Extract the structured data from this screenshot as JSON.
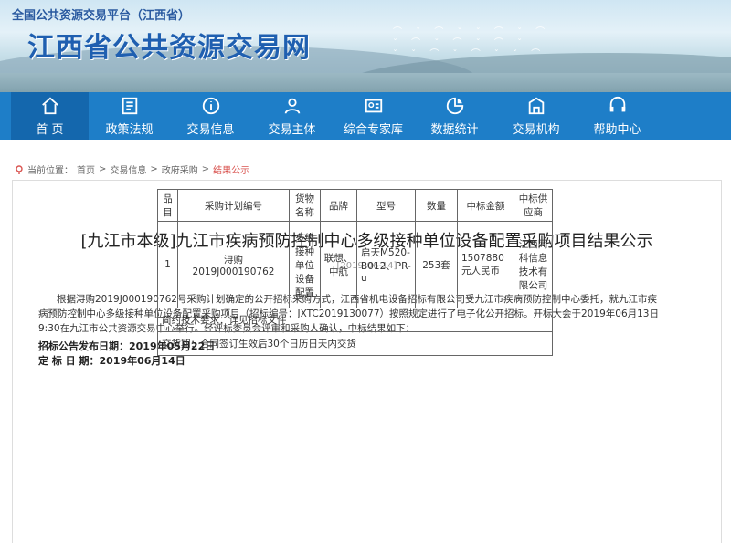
{
  "site": {
    "subtitle": "全国公共资源交易平台（江西省）",
    "title": "江西省公共资源交易网"
  },
  "nav": [
    {
      "label": "首 页",
      "icon": "home-icon"
    },
    {
      "label": "政策法规",
      "icon": "document-icon"
    },
    {
      "label": "交易信息",
      "icon": "info-icon"
    },
    {
      "label": "交易主体",
      "icon": "users-icon"
    },
    {
      "label": "综合专家库",
      "icon": "expert-icon"
    },
    {
      "label": "数据统计",
      "icon": "chart-icon"
    },
    {
      "label": "交易机构",
      "icon": "building-icon"
    },
    {
      "label": "帮助中心",
      "icon": "help-icon"
    }
  ],
  "breadcrumb": {
    "prefix": "当前位置：",
    "items": [
      "首页",
      "交易信息",
      "政府采购",
      "结果公示"
    ],
    "separator": ">"
  },
  "article": {
    "title": "[九江市本级]九江市疾病预防控制中心多级接种单位设备配置采购项目结果公示",
    "date": "[2019-06-14]",
    "body_lines": [
      "根据浔购2019J000190762号采购计划确定的公开招标采购方式，江西省机电设备招标有限公司受九江市疾病预防控制中心委托，就九江市疾",
      "病预防控制中心多级接种单位设备配置采购项目（招标编号：JXTC2019130077）按照规定进行了电子化公开招标。开标大会于2019年06月13日",
      "9:30在九江市公共资源交易中心举行。经评标委员会评审和采购人确认，中标结果如下："
    ],
    "publish_date": "招标公告发布日期：2019年05月22日",
    "decision_date": "定  标  日  期：2019年06月14日"
  },
  "table": {
    "headers": [
      "品目",
      "采购计划编号",
      "货物名称",
      "品牌",
      "型号",
      "数量",
      "中标金额",
      "中标供应商"
    ],
    "rows": [
      [
        "1",
        "浔购\n2019J000190762",
        "多级接种单位设备配置",
        "联想、中航",
        "启天M520-B012、PR-u",
        "253套",
        "1507880 元人民币",
        "江西同科信息技术有限公司"
      ]
    ],
    "tech_requirements": "简约技术要求：详见招标文件",
    "delivery": "交货期：合同签订生效后30个日历日天内交货"
  },
  "colors": {
    "nav_bg": "#1e7ec8",
    "nav_active": "#1467ad",
    "title_blue": "#1f5fb0",
    "crumb_current": "#d9534f"
  }
}
